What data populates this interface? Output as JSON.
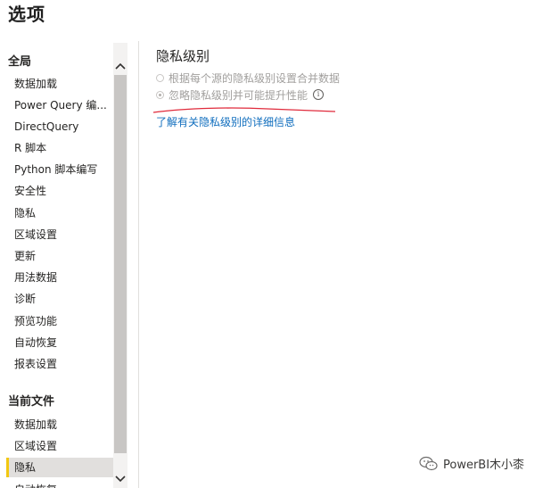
{
  "dialog": {
    "title": "选项"
  },
  "sidebar": {
    "global_heading": "全局",
    "global_items": [
      {
        "label": "数据加载"
      },
      {
        "label": "Power Query 编..."
      },
      {
        "label": "DirectQuery"
      },
      {
        "label": "R 脚本"
      },
      {
        "label": "Python 脚本编写"
      },
      {
        "label": "安全性"
      },
      {
        "label": "隐私"
      },
      {
        "label": "区域设置"
      },
      {
        "label": "更新"
      },
      {
        "label": "用法数据"
      },
      {
        "label": "诊断"
      },
      {
        "label": "预览功能"
      },
      {
        "label": "自动恢复"
      },
      {
        "label": "报表设置"
      }
    ],
    "current_heading": "当前文件",
    "current_items": [
      {
        "label": "数据加载"
      },
      {
        "label": "区域设置"
      },
      {
        "label": "隐私",
        "selected": true
      },
      {
        "label": "自动恢复"
      }
    ]
  },
  "content": {
    "heading": "隐私级别",
    "options": [
      {
        "label": "根据每个源的隐私级别设置合并数据",
        "checked": false
      },
      {
        "label": "忽略隐私级别并可能提升性能",
        "checked": true
      }
    ],
    "info_icon": "info-icon",
    "learn_more": "了解有关隐私级别的详细信息"
  },
  "watermark": {
    "text": "PowerBI木小桼",
    "icon": "wechat-icon"
  },
  "colors": {
    "link": "#106ebe",
    "annotation": "#e02b3c",
    "selected_bg": "#e1dfdd"
  }
}
